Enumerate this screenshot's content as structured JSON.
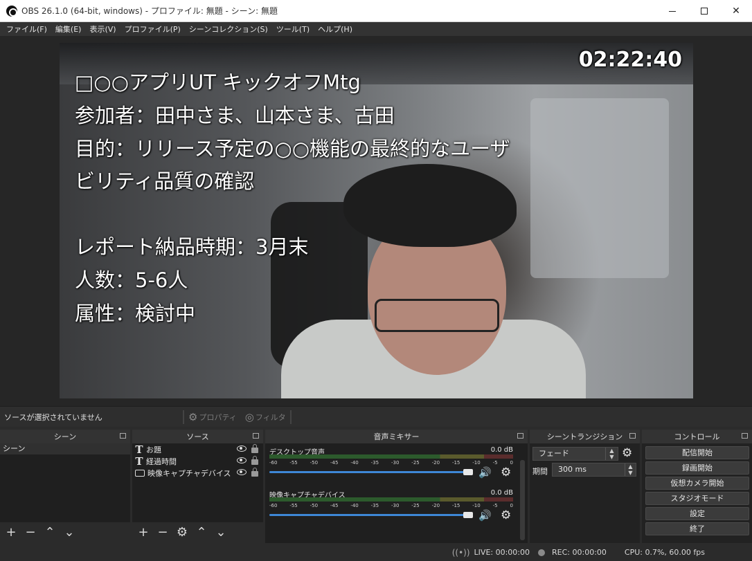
{
  "window": {
    "title": "OBS 26.1.0 (64-bit, windows) - プロファイル: 無題 - シーン: 無題",
    "controls": {
      "minimize": "—",
      "maximize": "☐",
      "close": "✕"
    }
  },
  "menu": [
    "ファイル(F)",
    "編集(E)",
    "表示(V)",
    "プロファイル(P)",
    "シーンコレクション(S)",
    "ツール(T)",
    "ヘルプ(H)"
  ],
  "preview": {
    "timer": "02:22:40",
    "lines": [
      "□○○アプリUT キックオフMtg",
      "参加者：田中さま、山本さま、古田",
      "目的：リリース予定の○○機能の最終的なユーザ",
      "ビリティ品質の確認",
      "レポート納品時期：3月末",
      "人数：5-6人",
      "属性：検討中"
    ]
  },
  "context": {
    "no_source": "ソースが選択されていません",
    "properties": "プロパティ",
    "filters": "フィルタ"
  },
  "docks": {
    "scenes": {
      "title": "シーン",
      "items": [
        "シーン"
      ]
    },
    "sources": {
      "title": "ソース",
      "items": [
        {
          "name": "お題",
          "type": "text"
        },
        {
          "name": "経過時間",
          "type": "text"
        },
        {
          "name": "映像キャプチャデバイス",
          "type": "camera"
        }
      ]
    },
    "mixer": {
      "title": "音声ミキサー",
      "ticks": [
        "-60",
        "-55",
        "-50",
        "-45",
        "-40",
        "-35",
        "-30",
        "-25",
        "-20",
        "-15",
        "-10",
        "-5",
        "0"
      ],
      "channels": [
        {
          "name": "デスクトップ音声",
          "db": "0.0 dB"
        },
        {
          "name": "映像キャプチャデバイス",
          "db": "0.0 dB"
        }
      ]
    },
    "transitions": {
      "title": "シーントランジション",
      "selected": "フェード",
      "duration_label": "期間",
      "duration": "300 ms"
    },
    "controls": {
      "title": "コントロール",
      "buttons": [
        "配信開始",
        "録画開始",
        "仮想カメラ開始",
        "スタジオモード",
        "設定",
        "終了"
      ]
    }
  },
  "status": {
    "live": "LIVE: 00:00:00",
    "rec": "REC: 00:00:00",
    "cpu": "CPU: 0.7%, 60.00 fps"
  }
}
